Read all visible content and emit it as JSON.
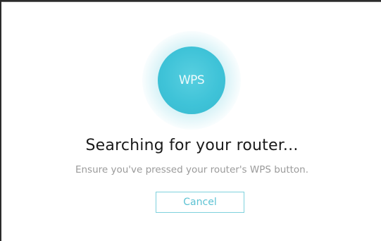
{
  "wps": {
    "label": "WPS"
  },
  "status": {
    "title": "Searching for your router...",
    "subtitle": "Ensure you've pressed your router's WPS button."
  },
  "actions": {
    "cancel_label": "Cancel"
  },
  "colors": {
    "accent": "#3fc3d8",
    "title_text": "#1a1a1a",
    "subtitle_text": "#9a9a9a"
  }
}
